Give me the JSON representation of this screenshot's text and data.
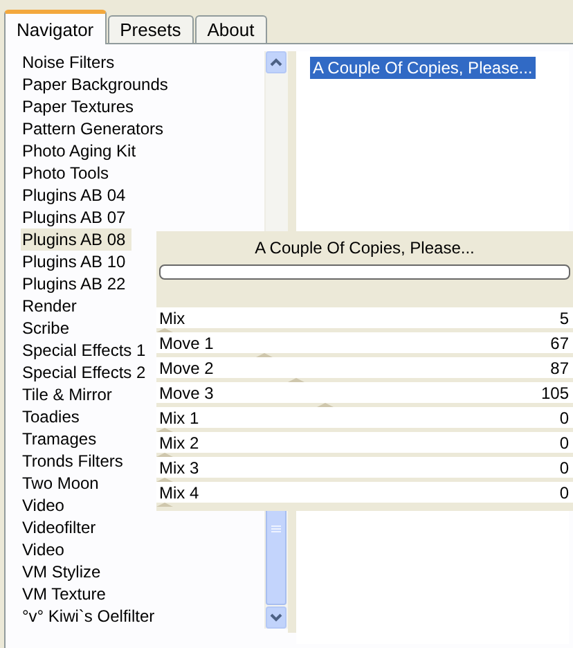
{
  "tabs": [
    {
      "label": "Navigator",
      "selected": true
    },
    {
      "label": "Presets",
      "selected": false
    },
    {
      "label": "About",
      "selected": false
    }
  ],
  "categories": [
    {
      "label": "Noise Filters",
      "selected": false
    },
    {
      "label": "Paper Backgrounds",
      "selected": false
    },
    {
      "label": "Paper Textures",
      "selected": false
    },
    {
      "label": "Pattern Generators",
      "selected": false
    },
    {
      "label": "Photo Aging Kit",
      "selected": false
    },
    {
      "label": "Photo Tools",
      "selected": false
    },
    {
      "label": "Plugins AB 04",
      "selected": false
    },
    {
      "label": "Plugins AB 07",
      "selected": false
    },
    {
      "label": "Plugins AB 08",
      "selected": true
    },
    {
      "label": "Plugins AB 10",
      "selected": false
    },
    {
      "label": "Plugins AB 22",
      "selected": false
    },
    {
      "label": "Render",
      "selected": false
    },
    {
      "label": "Scribe",
      "selected": false
    },
    {
      "label": "Special Effects 1",
      "selected": false
    },
    {
      "label": "Special Effects 2",
      "selected": false
    },
    {
      "label": "Tile & Mirror",
      "selected": false
    },
    {
      "label": "Toadies",
      "selected": false
    },
    {
      "label": "Tramages",
      "selected": false
    },
    {
      "label": "Tronds Filters",
      "selected": false
    },
    {
      "label": "Two Moon",
      "selected": false
    },
    {
      "label": "Video",
      "selected": false
    },
    {
      "label": "Videofilter",
      "selected": false
    },
    {
      "label": "Video",
      "selected": false
    },
    {
      "label": "VM Stylize",
      "selected": false
    },
    {
      "label": "VM Texture",
      "selected": false
    },
    {
      "label": "°v° Kiwi`s Oelfilter",
      "selected": false
    }
  ],
  "filters": [
    {
      "label": "A Couple Of Copies, Please...",
      "selected": true
    }
  ],
  "dialog": {
    "title": "A Couple Of Copies, Please...",
    "progress": {
      "level": 0
    },
    "controls": [
      {
        "label": "Mix",
        "value": "5",
        "level": 0.02
      },
      {
        "label": "Move 1",
        "value": "67",
        "level": 0.263
      },
      {
        "label": "Move 2",
        "value": "87",
        "level": 0.341
      },
      {
        "label": "Move 3",
        "value": "105",
        "level": 0.412
      },
      {
        "label": "Mix 1",
        "value": "0",
        "level": 0
      },
      {
        "label": "Mix 2",
        "value": "0",
        "level": 0
      },
      {
        "label": "Mix 3",
        "value": "0",
        "level": 0
      },
      {
        "label": "Mix 4",
        "value": "0",
        "level": 0
      }
    ]
  }
}
